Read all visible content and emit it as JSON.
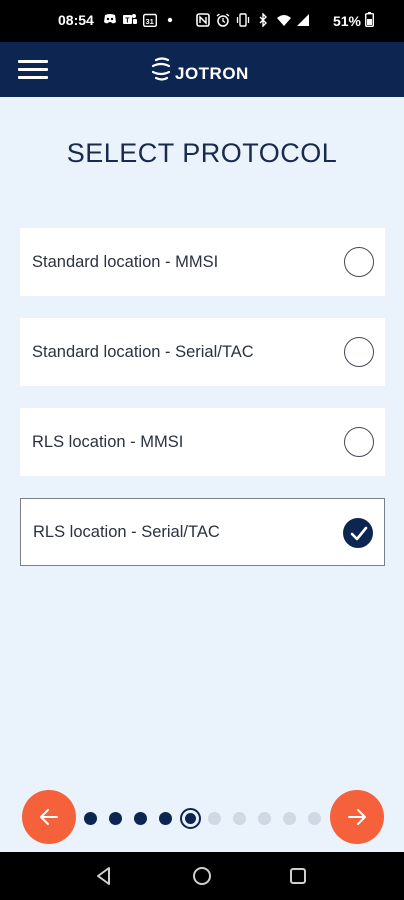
{
  "status_bar": {
    "time": "08:54",
    "notification_icons": [
      "discord-icon",
      "teams-icon",
      "calendar-icon",
      "dot-icon"
    ],
    "system_icons": [
      "nfc-icon",
      "alarm-icon",
      "vibrate-icon",
      "bluetooth-icon",
      "wifi-icon",
      "signal-icon"
    ],
    "battery_percent": "51%"
  },
  "app_bar": {
    "menu_icon": "hamburger-menu-icon",
    "logo_text": "JOTRON",
    "background": "#0d2651"
  },
  "page": {
    "title": "SELECT PROTOCOL"
  },
  "options": [
    {
      "label": "Standard location - MMSI",
      "selected": false
    },
    {
      "label": "Standard location - Serial/TAC",
      "selected": false
    },
    {
      "label": "RLS location - MMSI",
      "selected": false
    },
    {
      "label": "RLS location - Serial/TAC",
      "selected": true
    }
  ],
  "pager": {
    "total_steps": 10,
    "completed_steps": 4,
    "current_step": 5,
    "accent_color": "#f4613b"
  },
  "system_nav": [
    "back-icon",
    "home-icon",
    "recents-icon"
  ]
}
